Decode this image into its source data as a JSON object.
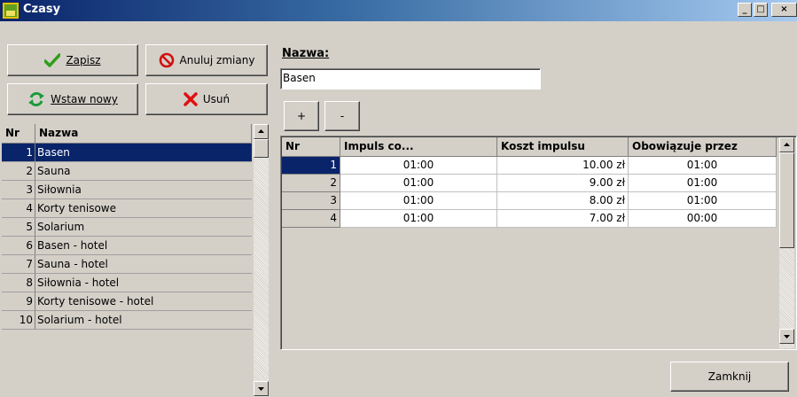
{
  "window": {
    "title": "Czasy",
    "minimize": "_",
    "maximize": "□",
    "close": "×"
  },
  "toolbar": {
    "save_label": "Zapisz",
    "cancel_label": "Anuluj zmiany",
    "insert_label": "Wstaw nowy",
    "delete_label": "Usuń"
  },
  "list": {
    "columns": [
      "Nr",
      "Nazwa"
    ],
    "rows": [
      {
        "nr": "1",
        "name": "Basen"
      },
      {
        "nr": "2",
        "name": "Sauna"
      },
      {
        "nr": "3",
        "name": "Siłownia"
      },
      {
        "nr": "4",
        "name": "Korty tenisowe"
      },
      {
        "nr": "5",
        "name": "Solarium"
      },
      {
        "nr": "6",
        "name": "Basen - hotel"
      },
      {
        "nr": "7",
        "name": "Sauna - hotel"
      },
      {
        "nr": "8",
        "name": "Siłownia - hotel"
      },
      {
        "nr": "9",
        "name": "Korty tenisowe - hotel"
      },
      {
        "nr": "10",
        "name": "Solarium - hotel"
      }
    ],
    "selected_index": 0
  },
  "detail": {
    "name_label": "Nazwa:",
    "name_value": "Basen",
    "add_label": "+",
    "remove_label": "-",
    "grid": {
      "columns": [
        "Nr",
        "Impuls co...",
        "Koszt impulsu",
        "Obowiązuje przez"
      ],
      "rows": [
        [
          "1",
          "01:00",
          "10.00 zł",
          "01:00"
        ],
        [
          "2",
          "01:00",
          "9.00 zł",
          "01:00"
        ],
        [
          "3",
          "01:00",
          "8.00 zł",
          "01:00"
        ],
        [
          "4",
          "01:00",
          "7.00 zł",
          "00:00"
        ]
      ]
    },
    "close_label": "Zamknij"
  },
  "icons": {
    "save": "checkmark-icon",
    "cancel": "no-entry-icon",
    "insert": "refresh-icon",
    "delete": "x-mark-icon"
  },
  "colors": {
    "selection": "#0a246a",
    "save_icon": "#2e9e1a",
    "cancel_icon": "#d01010",
    "insert_icon": "#1a9a3a",
    "delete_icon": "#e01010"
  }
}
